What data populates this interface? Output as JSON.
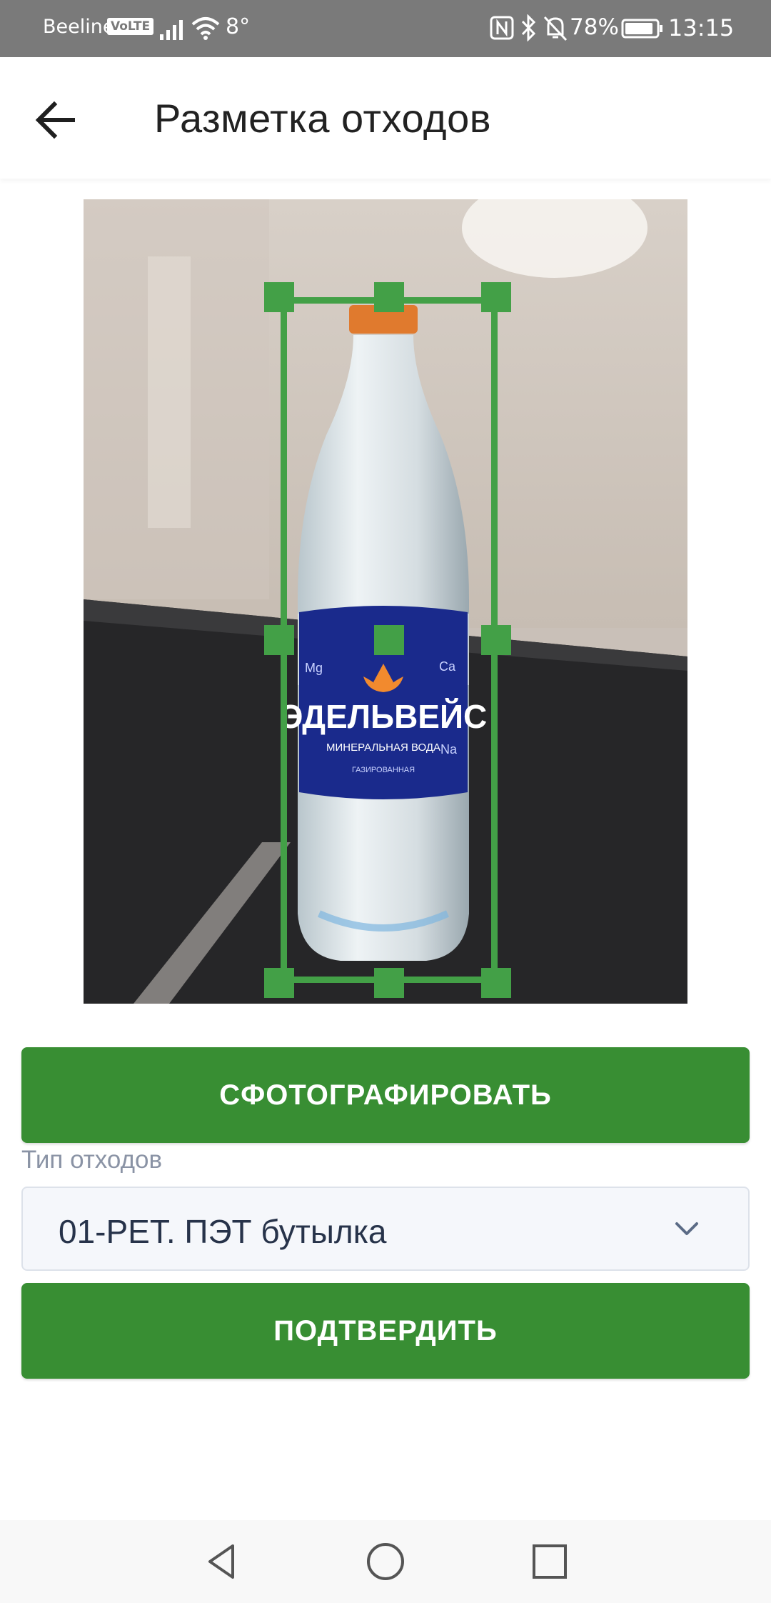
{
  "status_bar": {
    "carrier": "Beeline",
    "volte": "VoLTE",
    "temperature": "8°",
    "battery_percent": "78%",
    "time": "13:15",
    "icons": [
      "signal-icon",
      "wifi-icon",
      "nfc-icon",
      "bluetooth-icon",
      "mute-icon",
      "battery-icon"
    ]
  },
  "app_bar": {
    "back_icon": "arrow-left-icon",
    "title": "Разметка отходов"
  },
  "photo": {
    "subject": "bottle",
    "label_brand": "ЭДЕЛЬВЕЙС",
    "label_subtitle": "МИНЕРАЛЬНАЯ ВОДА",
    "label_small": "ГАЗИРОВАННАЯ",
    "label_mg": "Mg",
    "label_ca": "Ca",
    "label_na": "Na",
    "bbox_color": "#43a047"
  },
  "actions": {
    "capture_label": "СФОТОГРАФИРОВАТЬ",
    "confirm_label": "ПОДТВЕРДИТЬ"
  },
  "waste_type": {
    "label": "Тип отходов",
    "selected": "01-PET.  ПЭТ бутылка"
  },
  "nav_bar": {
    "icons": [
      "back-triangle-icon",
      "home-circle-icon",
      "recents-square-icon"
    ]
  },
  "colors": {
    "accent": "#388e33",
    "status_bar": "#7a7a7a"
  }
}
